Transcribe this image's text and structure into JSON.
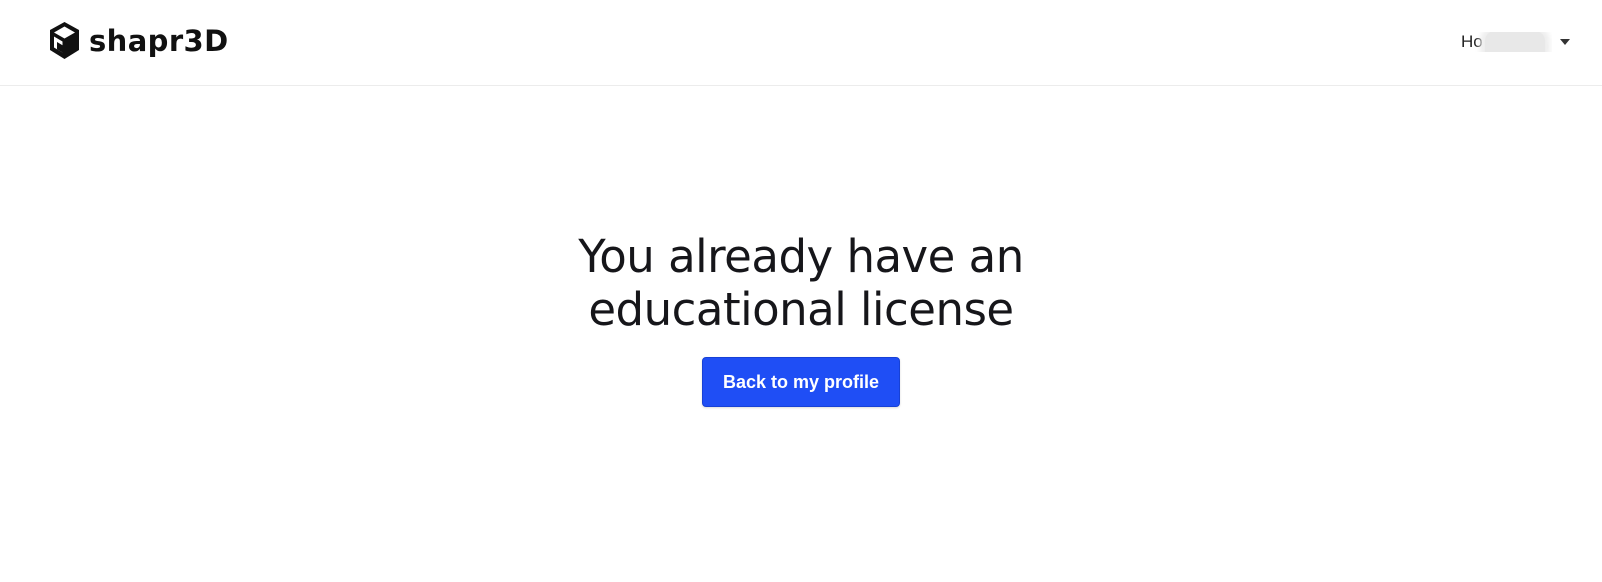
{
  "header": {
    "logo_text": "shapr3D",
    "user_name_visible": "Ho          e"
  },
  "main": {
    "title": "You already have an educational license",
    "back_button_label": "Back to my profile"
  },
  "colors": {
    "accent": "#1f4ef5",
    "text": "#16161a",
    "header_border": "#ececec"
  },
  "icons": {
    "logo": "shapr3d-logo-icon",
    "user_menu": "caret-down-icon"
  }
}
